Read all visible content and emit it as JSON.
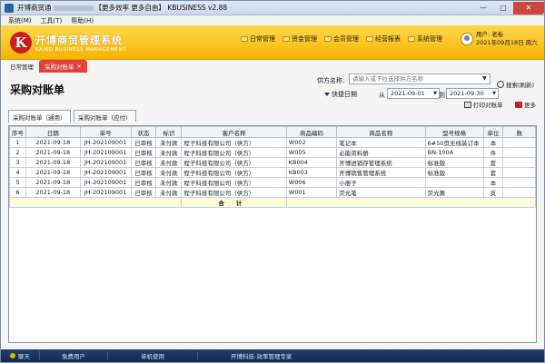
{
  "window": {
    "title_prefix": "开博商贸通",
    "title_mid": "【更多效率 更多自由】",
    "title_suffix": "KBUSINESS v2.88"
  },
  "menubar": [
    "系统(M)",
    "工具(T)",
    "帮助(H)"
  ],
  "logo": {
    "cn": "开博商贸管理系统",
    "en": "KAIBO BUSINESS MANAGEMENT",
    "mark": "K"
  },
  "nav": [
    "日常管理",
    "资金管理",
    "会员管理",
    "经营报表",
    "系统管理"
  ],
  "user": {
    "name": "用户: 老板",
    "date": "2021年09月18日 周六"
  },
  "tabs": {
    "home": "日常管理",
    "active": "采购对账单"
  },
  "page_title": "采购对账单",
  "filters": {
    "supplier_label": "供方名称:",
    "supplier_placeholder": "请输入或下拉选择供方名称",
    "search_label": "搜索(刷新)",
    "shortcut_label": "快捷日期",
    "from_label": "从",
    "from_date": "2021-09-01",
    "to_label": "到",
    "to_date": "2021-09-30"
  },
  "subtabs": [
    "采购对账单（通用）",
    "采购对账单（应付）"
  ],
  "actions": {
    "print": "打印对账单",
    "more": "更多"
  },
  "table": {
    "columns": [
      "序号",
      "日期",
      "单号",
      "状态",
      "标识",
      "客户名称",
      "商品编码",
      "商品名称",
      "型号规格",
      "单位",
      "数"
    ],
    "rows": [
      [
        "1",
        "2021-09-18",
        "JH-202109001",
        "已审核",
        "未付款",
        "程子科技有限公司（供方）",
        "W002",
        "笔记本",
        "6#50页无线装订本",
        "本",
        ""
      ],
      [
        "2",
        "2021-09-18",
        "JH-202109001",
        "已审核",
        "未付款",
        "程子科技有限公司（供方）",
        "W005",
        "必能资料册",
        "BN-100A",
        "件",
        ""
      ],
      [
        "3",
        "2021-09-18",
        "JH-202109001",
        "已审核",
        "未付款",
        "程子科技有限公司（供方）",
        "KB004",
        "开博进销存管理系统",
        "标准版",
        "套",
        ""
      ],
      [
        "4",
        "2021-09-18",
        "JH-202109001",
        "已审核",
        "未付款",
        "程子科技有限公司（供方）",
        "KB003",
        "开博销售管理系统",
        "标准版",
        "套",
        ""
      ],
      [
        "5",
        "2021-09-18",
        "JH-202109001",
        "已审核",
        "未付款",
        "程子科技有限公司（供方）",
        "W006",
        "小册子",
        "",
        "本",
        ""
      ],
      [
        "6",
        "2021-09-18",
        "JH-202109001",
        "已审核",
        "未付款",
        "程子科技有限公司（供方）",
        "W001",
        "荧光笔",
        "荧光黄",
        "支",
        ""
      ]
    ],
    "total_label": "合　　计"
  },
  "statusbar": [
    "聊天",
    "免费用户",
    "单机使用",
    "开博科技-效率管理专家"
  ]
}
